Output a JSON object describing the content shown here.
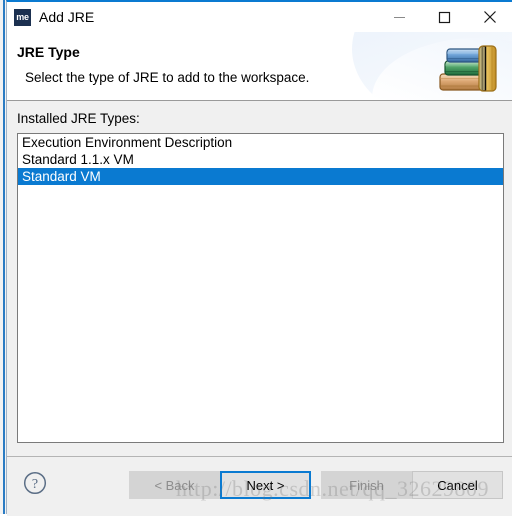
{
  "window": {
    "title": "Add JRE",
    "icon_name": "me-app-icon",
    "icon_text": "me",
    "controls": [
      {
        "name": "minimize-button",
        "glyph": "minimize"
      },
      {
        "name": "maximize-button",
        "glyph": "maximize"
      },
      {
        "name": "close-button",
        "glyph": "close"
      }
    ]
  },
  "header": {
    "title": "JRE Type",
    "description": "Select the type of JRE to add to the workspace.",
    "icon_name": "books-icon"
  },
  "main": {
    "list_label": "Installed JRE Types:",
    "items": [
      {
        "label": "Execution Environment Description",
        "selected": false
      },
      {
        "label": "Standard 1.1.x VM",
        "selected": false
      },
      {
        "label": "Standard VM",
        "selected": true
      }
    ]
  },
  "footer": {
    "help_icon": "help-question-icon",
    "buttons": [
      {
        "id": "back",
        "label": "< Back",
        "state": "disabled"
      },
      {
        "id": "next",
        "label": "Next >",
        "state": "focused"
      },
      {
        "id": "finish",
        "label": "Finish",
        "state": "disabled"
      },
      {
        "id": "cancel",
        "label": "Cancel",
        "state": "enabled"
      }
    ]
  },
  "watermark": {
    "text": "http://blog.csdn.net/qq_32629809"
  },
  "colors": {
    "accent": "#0a7ad1",
    "selection": "#0a7ad1",
    "dialog_bg": "#f0f0f0",
    "panel_bg": "#ffffff",
    "disabled_text": "#8d8d8d"
  }
}
